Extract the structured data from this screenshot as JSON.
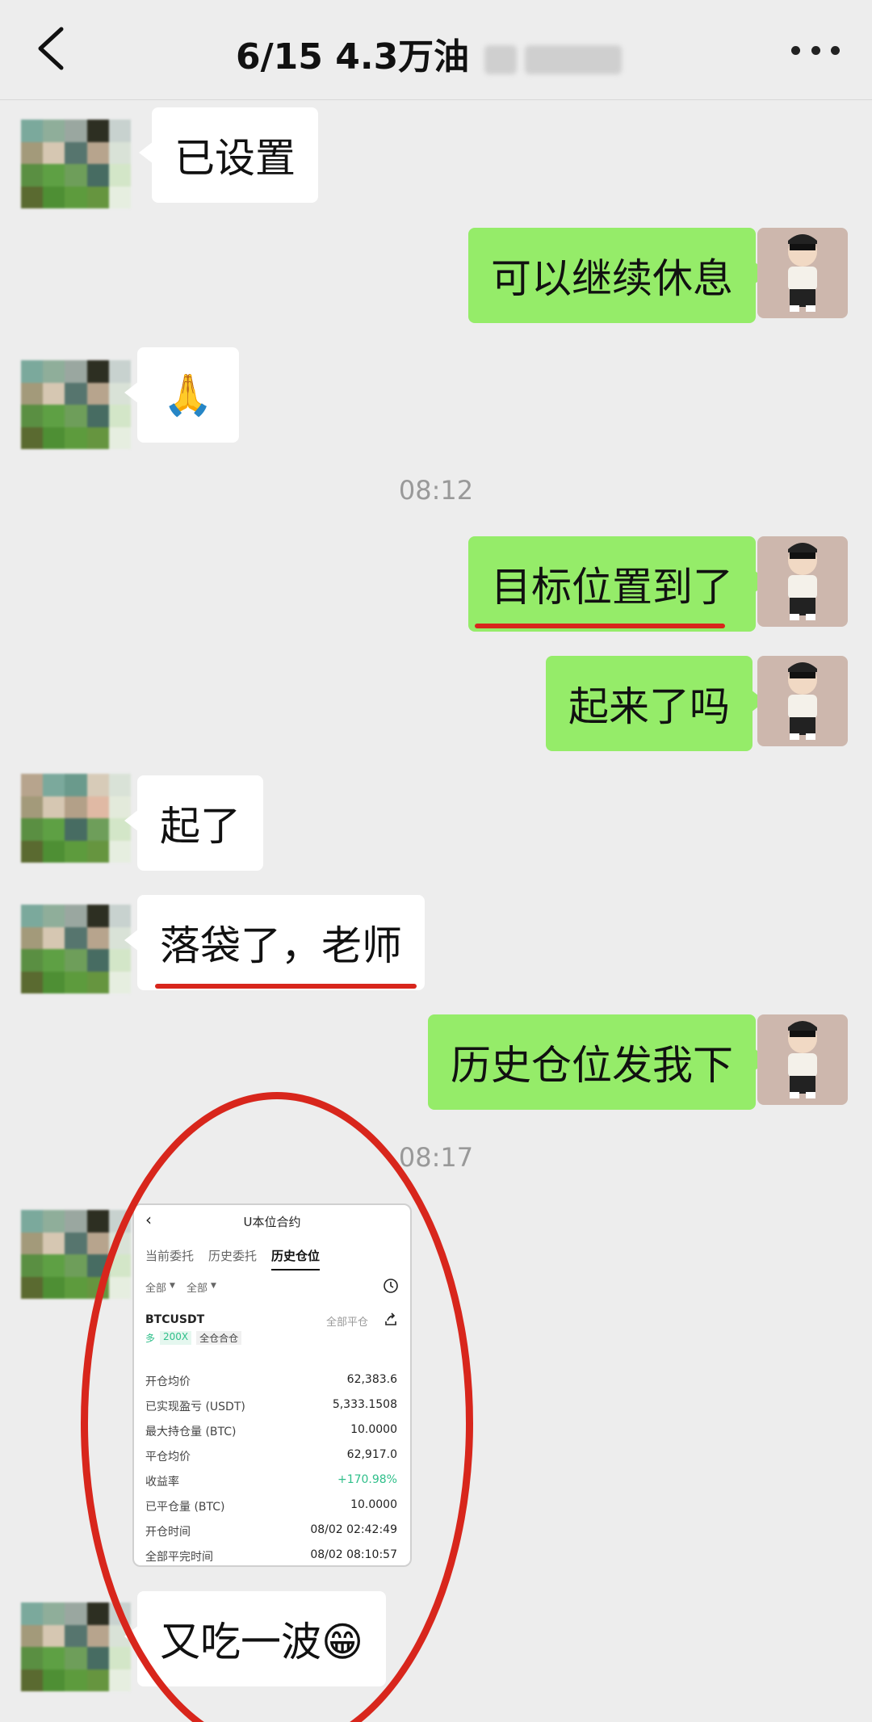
{
  "header": {
    "back_icon": "chevron-left-icon",
    "title": "6/15  4.3万油",
    "more_icon": "more-horizontal-icon"
  },
  "messages": {
    "m1": "已设置",
    "m2": "可以继续休息",
    "m3_emoji": "🙏",
    "time1": "08:12",
    "m4": "目标位置到了",
    "m5": "起来了吗",
    "m6": "起了",
    "m7": "落袋了，老师",
    "m8": "历史仓位发我下",
    "time2": "08:17",
    "m10": "又吃一波😁"
  },
  "screenshot": {
    "nav_title": "U本位合约",
    "tabs": [
      "当前委托",
      "历史委托",
      "历史仓位"
    ],
    "filters": [
      "全部",
      "全部"
    ],
    "symbol": "BTCUSDT",
    "close_all": "全部平仓",
    "tag_long": "多",
    "tag_leverage": "200X",
    "tag_mode": "全仓合仓",
    "rows": [
      {
        "label": "开仓均价",
        "value": "62,383.6"
      },
      {
        "label": "已实现盈亏 (USDT)",
        "value": "5,333.1508"
      },
      {
        "label": "最大持仓量 (BTC)",
        "value": "10.0000"
      },
      {
        "label": "平仓均价",
        "value": "62,917.0"
      },
      {
        "label": "收益率",
        "value": "+170.98%"
      },
      {
        "label": "已平仓量 (BTC)",
        "value": "10.0000"
      },
      {
        "label": "开仓时间",
        "value": "08/02 02:42:49"
      },
      {
        "label": "全部平完时间",
        "value": "08/02 08:10:57"
      }
    ]
  },
  "colors": {
    "out_bubble": "#95ec69",
    "in_bubble": "#ffffff",
    "annotation": "#d8261c",
    "profit": "#2fbf8a"
  }
}
